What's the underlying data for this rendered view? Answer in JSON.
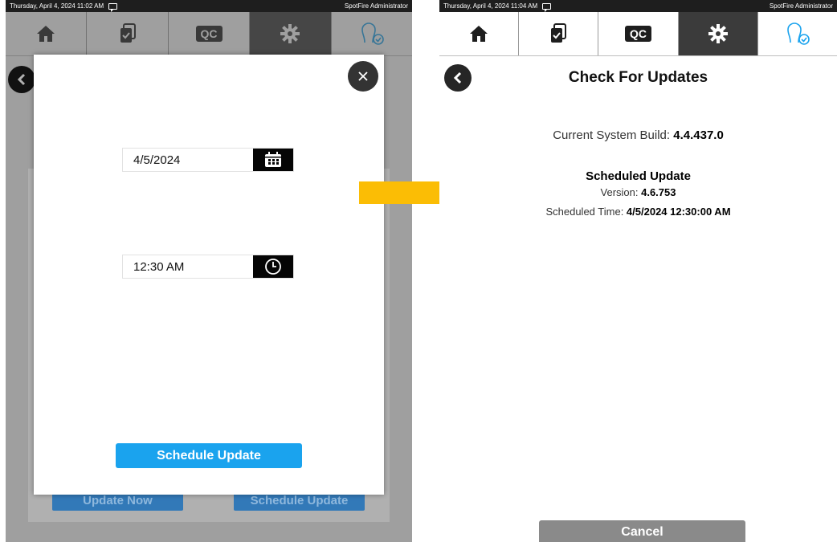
{
  "left_screen": {
    "status": {
      "datetime": "Thursday, April 4, 2024 11:02 AM",
      "user": "SpotFire Administrator"
    },
    "nav": {
      "qc_label": "QC"
    },
    "background_buttons": {
      "update_now": "Update Now",
      "schedule_update": "Schedule Update"
    },
    "modal": {
      "date_value": "4/5/2024",
      "time_value": "12:30 AM",
      "schedule_button": "Schedule Update"
    }
  },
  "right_screen": {
    "status": {
      "datetime": "Thursday, April 4, 2024 11:04 AM",
      "user": "SpotFire Administrator"
    },
    "nav": {
      "qc_label": "QC"
    },
    "title": "Check For Updates",
    "current_build_label": "Current System Build: ",
    "current_build_value": "4.4.437.0",
    "scheduled_heading": "Scheduled Update",
    "version_label": "Version: ",
    "version_value": "4.6.753",
    "scheduled_time_label": "Scheduled Time: ",
    "scheduled_time_value": "4/5/2024 12:30:00 AM",
    "cancel_button": "Cancel"
  },
  "colors": {
    "accent_blue": "#1aa3ee",
    "arrow_yellow": "#fbbd05",
    "nav_active": "#3b3b3b",
    "user_icon_blue": "#1aa3ee"
  },
  "icons": [
    "home-icon",
    "copy-check-icon",
    "qc-icon",
    "gear-icon",
    "user-check-icon",
    "back-icon",
    "close-icon",
    "calendar-icon",
    "clock-icon",
    "message-icon"
  ]
}
